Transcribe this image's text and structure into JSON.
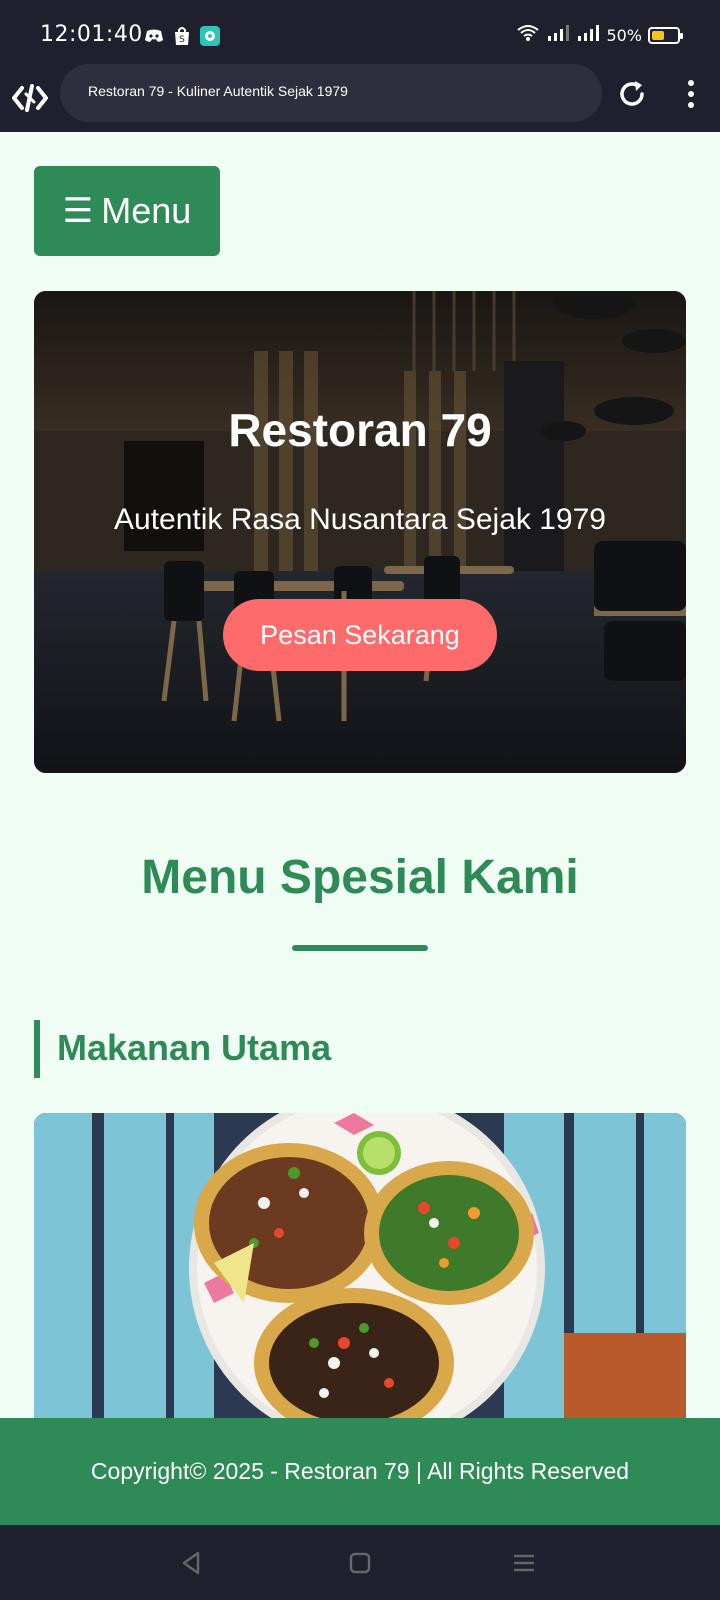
{
  "status_bar": {
    "time": "12:01:40",
    "battery_percent": "50%",
    "battery_level": 0.5,
    "left_icons": [
      "discord-icon",
      "shopping-bag-icon",
      "chat-app-icon"
    ],
    "right_icons": [
      "wifi-icon",
      "signal-icon",
      "signal-icon"
    ]
  },
  "browser": {
    "page_title": "Restoran 79 - Kuliner Autentik Sejak 1979"
  },
  "page": {
    "menu_label": "Menu",
    "menu_glyph": "☰",
    "hero": {
      "title": "Restoran 79",
      "subtitle": "Autentik Rasa Nusantara Sejak 1979",
      "cta": "Pesan Sekarang"
    },
    "section_title": "Menu Spesial Kami",
    "category_title": "Makanan Utama",
    "footer_text": "Copyright© 2025 - Restoran 79 | All Rights Reserved"
  },
  "colors": {
    "primary": "#2e8b57",
    "accent": "#ff6b6b",
    "background": "#f0fdf4",
    "system_bar": "#1f1f2e"
  }
}
